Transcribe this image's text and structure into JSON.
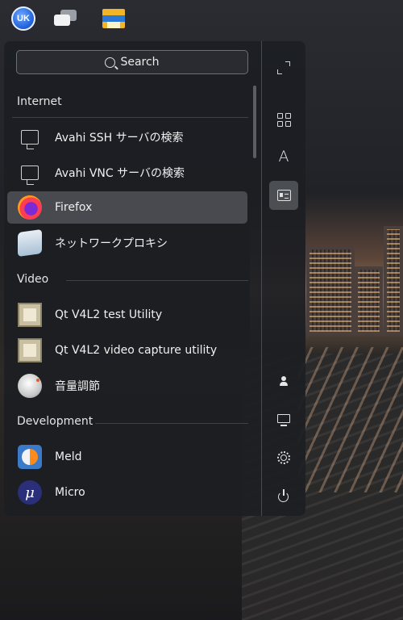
{
  "taskbar": {
    "items": [
      {
        "name": "start-menu-logo",
        "text": "UK"
      },
      {
        "name": "show-desktop-icon"
      },
      {
        "name": "file-manager-icon"
      }
    ]
  },
  "search": {
    "label": "Search"
  },
  "sections": {
    "internet": "Internet",
    "video": "Video",
    "development": "Development"
  },
  "apps": [
    {
      "label": "Avahi SSH サーバの検索",
      "icon": "network-icon"
    },
    {
      "label": "Avahi VNC サーバの検索",
      "icon": "network-icon"
    },
    {
      "label": "Firefox",
      "icon": "firefox-icon",
      "highlighted": true
    },
    {
      "label": "ネットワークプロキシ",
      "icon": "proxy-icon"
    },
    {
      "label": "Qt V4L2 test Utility",
      "icon": "qt-v4l2-icon"
    },
    {
      "label": "Qt V4L2 video capture utility",
      "icon": "qt-v4l2-icon"
    },
    {
      "label": "音量調節",
      "icon": "volume-icon"
    },
    {
      "label": "Meld",
      "icon": "meld-icon"
    },
    {
      "label": "Micro",
      "icon": "micro-icon",
      "glyph": "μ"
    }
  ],
  "sidebar": {
    "buttons": [
      {
        "name": "fullscreen-button",
        "icon": "expand-icon"
      },
      {
        "name": "view-grid-button",
        "icon": "grid-icon"
      },
      {
        "name": "view-alphabetical-button",
        "icon": "alpha-icon",
        "glyph": "A"
      },
      {
        "name": "view-category-button",
        "icon": "card-icon",
        "active": true
      },
      {
        "name": "user-button",
        "icon": "user-icon"
      },
      {
        "name": "computer-button",
        "icon": "monitor-icon"
      },
      {
        "name": "settings-button",
        "icon": "settings-icon"
      },
      {
        "name": "power-button",
        "icon": "power-icon"
      }
    ]
  },
  "colors": {
    "panel": "#1c1e22",
    "highlight": "#5a5c61",
    "text": "#f0f0f0"
  }
}
